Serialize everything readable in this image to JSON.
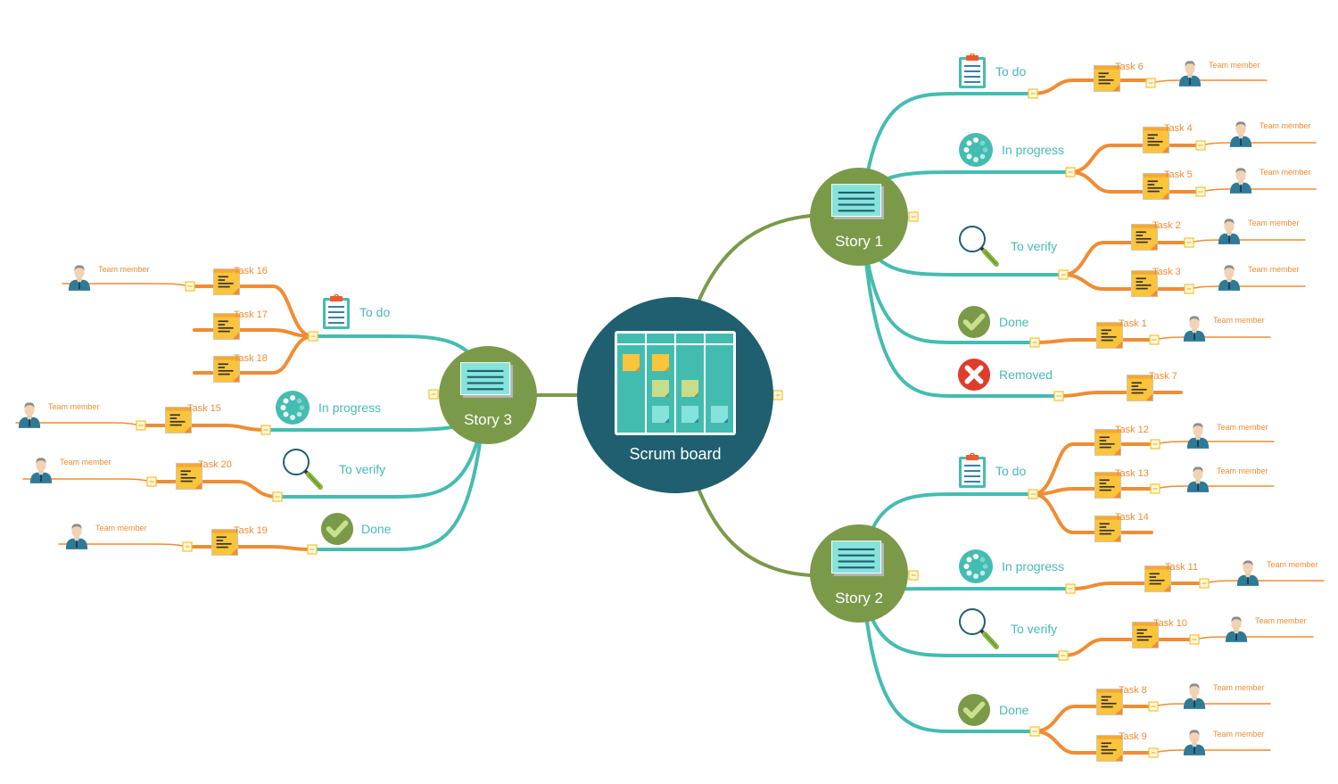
{
  "diagram": {
    "title": "Scrum board",
    "colors": {
      "root": "#1f5f6f",
      "story": "#7a9a4a",
      "branch_green": "#7a9a4a",
      "status_line": "#45bcb1",
      "task_line": "#f08c33",
      "status_text": "#45bcb1",
      "task_text": "#f08c33",
      "board_teal": "#43bcb0",
      "sticky_yellow": "#fbc43a",
      "done_green": "#7a9a4a",
      "removed_red": "#e03c2c"
    },
    "stories": [
      {
        "name": "Story 1",
        "statuses": [
          {
            "label": "To do",
            "icon": "clipboard-icon",
            "tasks": [
              {
                "name": "Task 6",
                "member": "Team member"
              }
            ]
          },
          {
            "label": "In progress",
            "icon": "progress-spinner-icon",
            "tasks": [
              {
                "name": "Task 4",
                "member": "Team member"
              },
              {
                "name": "Task 5",
                "member": "Team member"
              }
            ]
          },
          {
            "label": "To verify",
            "icon": "magnifier-icon",
            "tasks": [
              {
                "name": "Task 2",
                "member": "Team member"
              },
              {
                "name": "Task 3",
                "member": "Team member"
              }
            ]
          },
          {
            "label": "Done",
            "icon": "checkmark-icon",
            "tasks": [
              {
                "name": "Task 1",
                "member": "Team member"
              }
            ]
          },
          {
            "label": "Removed",
            "icon": "removed-x-icon",
            "tasks": [
              {
                "name": "Task 7",
                "member": null
              }
            ]
          }
        ]
      },
      {
        "name": "Story 2",
        "statuses": [
          {
            "label": "To do",
            "icon": "clipboard-icon",
            "tasks": [
              {
                "name": "Task 12",
                "member": "Team member"
              },
              {
                "name": "Task 13",
                "member": "Team member"
              },
              {
                "name": "Task 14",
                "member": null
              }
            ]
          },
          {
            "label": "In progress",
            "icon": "progress-spinner-icon",
            "tasks": [
              {
                "name": "Task 11",
                "member": "Team member"
              }
            ]
          },
          {
            "label": "To verify",
            "icon": "magnifier-icon",
            "tasks": [
              {
                "name": "Task 10",
                "member": "Team member"
              }
            ]
          },
          {
            "label": "Done",
            "icon": "checkmark-icon",
            "tasks": [
              {
                "name": "Task 8",
                "member": "Team member"
              },
              {
                "name": "Task 9",
                "member": "Team member"
              }
            ]
          }
        ]
      },
      {
        "name": "Story 3",
        "statuses": [
          {
            "label": "To do",
            "icon": "clipboard-icon",
            "tasks": [
              {
                "name": "Task 16",
                "member": "Team member"
              },
              {
                "name": "Task 17",
                "member": null
              },
              {
                "name": "Task 18",
                "member": null
              }
            ]
          },
          {
            "label": "In progress",
            "icon": "progress-spinner-icon",
            "tasks": [
              {
                "name": "Task 15",
                "member": "Team member"
              }
            ]
          },
          {
            "label": "To verify",
            "icon": "magnifier-icon",
            "tasks": [
              {
                "name": "Task 20",
                "member": "Team member"
              }
            ]
          },
          {
            "label": "Done",
            "icon": "checkmark-icon",
            "tasks": [
              {
                "name": "Task 19",
                "member": "Team member"
              }
            ]
          }
        ]
      }
    ]
  }
}
